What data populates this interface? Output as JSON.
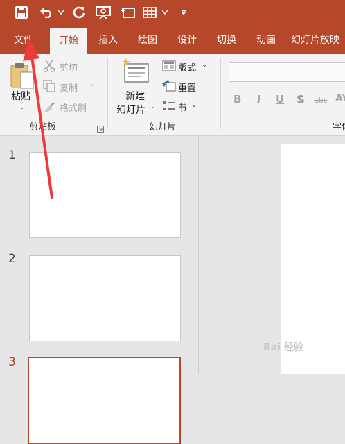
{
  "quick_access": {
    "icons": [
      "save-icon",
      "undo-icon",
      "redo-icon",
      "slideshow-icon",
      "new-slide-icon",
      "table-icon",
      "customize-icon"
    ]
  },
  "tabs": [
    {
      "label": "文件",
      "active": false
    },
    {
      "label": "开始",
      "active": true
    },
    {
      "label": "插入",
      "active": false
    },
    {
      "label": "绘图",
      "active": false
    },
    {
      "label": "设计",
      "active": false
    },
    {
      "label": "切换",
      "active": false
    },
    {
      "label": "动画",
      "active": false
    },
    {
      "label": "幻灯片放映",
      "active": false
    }
  ],
  "clipboard": {
    "paste_label": "粘贴",
    "cut_label": "剪切",
    "copy_label": "复制",
    "format_painter_label": "格式刷",
    "group_label": "剪贴板"
  },
  "slides_group": {
    "new_slide_line1": "新建",
    "new_slide_line2": "幻灯片",
    "layout_label": "版式",
    "reset_label": "重置",
    "section_label": "节",
    "group_label": "幻灯片"
  },
  "font_group": {
    "group_label": "字体",
    "bold": "B",
    "italic": "I",
    "underline": "U",
    "shadow": "S",
    "strike": "abc",
    "av": "AV"
  },
  "thumbnails": [
    {
      "number": "1",
      "selected": false
    },
    {
      "number": "2",
      "selected": false
    },
    {
      "number": "3",
      "selected": true
    }
  ],
  "watermark": "Bai 经验",
  "colors": {
    "accent": "#b7472a",
    "arrow": "#ee3a3a"
  }
}
